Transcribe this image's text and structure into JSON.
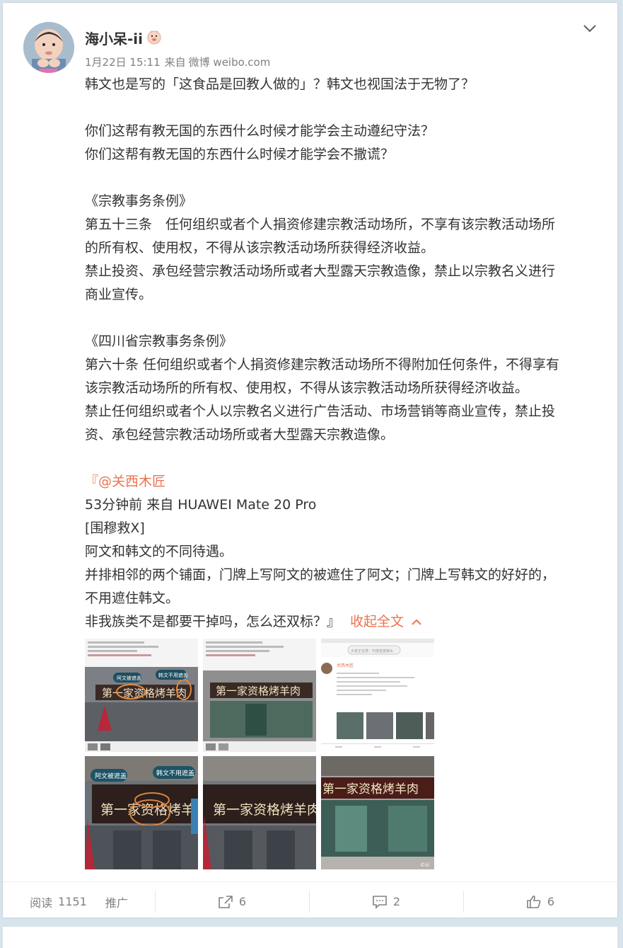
{
  "post": {
    "username": "海小呆-ii",
    "badge_icon": "pig-face-icon",
    "time": "1月22日 15:11",
    "source_prefix": "来自",
    "source_name": "微博 weibo.com",
    "paragraphs": [
      "韩文也是写的「这食品是回教人做的」？韩文也视国法于无物了？",
      "",
      "你们这帮有教无国的东西什么时候才能学会主动遵纪守法？",
      "你们这帮有教无国的东西什么时候才能学会不撒谎？",
      "",
      "《宗教事务条例》",
      "第五十三条　任何组织或者个人捐资修建宗教活动场所，不享有该宗教活动场所",
      "的所有权、使用权，不得从该宗教活动场所获得经济收益。",
      "禁止投资、承包经营宗教活动场所或者大型露天宗教造像，禁止以宗教名义进行",
      "商业宣传。",
      "",
      "《四川省宗教事务条例》",
      "第六十条 任何组织或者个人捐资修建宗教活动场所不得附加任何条件，不得享有",
      "该宗教活动场所的所有权、使用权，不得从该宗教活动场所获得经济收益。",
      "禁止任何组织或者个人以宗教名义进行广告活动、市场营销等商业宣传，禁止投",
      "资、承包经营宗教活动场所或者大型露天宗教造像。",
      ""
    ],
    "quote_open": "『",
    "mention": "@关西木匠",
    "quote_lines": [
      "53分钟前 来自 HUAWEI Mate 20 Pro",
      "[围穆救X]",
      "阿文和韩文的不同待遇。",
      "并排相邻的两个铺面，门牌上写阿文的被遮住了阿文；门牌上写韩文的好好的，",
      "不用遮住韩文。"
    ],
    "last_line": "非我族类不是都要干掉吗，怎么还双标？』",
    "collapse_label": "收起全文",
    "images": {
      "banner_large": "第一家资格烤羊肉",
      "label_covered": "阿文被遮盖",
      "label_not_covered": "韩文不用遮盖",
      "small_label_1": "阿文被遮盖",
      "small_label_2": "韩文不用遮盖",
      "screenshot_user": "关西木匠",
      "search_placeholder": "大家正在搜：印度首富嫁女",
      "watermark": "©iii"
    }
  },
  "footer": {
    "read_label": "阅读",
    "read_count": "1151",
    "promote_label": "推广",
    "repost_count": "6",
    "comment_count": "2",
    "like_count": "6"
  },
  "colors": {
    "accent": "#eb7350",
    "page_bg": "#d8e4ec"
  }
}
